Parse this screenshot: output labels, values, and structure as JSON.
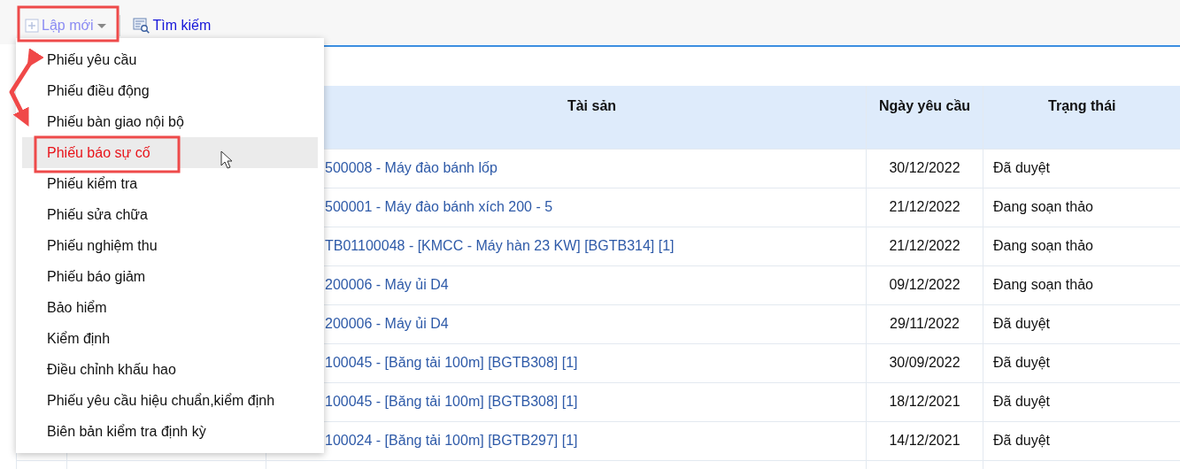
{
  "toolbar": {
    "buttons": [
      {
        "label": "Lập mới",
        "kind": "dropdown"
      },
      {
        "label": "Tìm kiếm",
        "kind": "search"
      }
    ]
  },
  "menu": {
    "items": [
      {
        "label": "Phiếu yêu cầu",
        "selected": false
      },
      {
        "label": "Phiếu điều động",
        "selected": false
      },
      {
        "label": "Phiếu bàn giao nội bộ",
        "selected": false
      },
      {
        "label": "Phiếu báo sự cố",
        "selected": true
      },
      {
        "label": "Phiếu kiểm tra",
        "selected": false
      },
      {
        "label": "Phiếu sửa chữa",
        "selected": false
      },
      {
        "label": "Phiếu nghiệm thu",
        "selected": false
      },
      {
        "label": "Phiếu báo giảm",
        "selected": false
      },
      {
        "label": "Bảo hiểm",
        "selected": false
      },
      {
        "label": "Kiểm định",
        "selected": false
      },
      {
        "label": "Điều chỉnh khấu hao",
        "selected": false
      },
      {
        "label": "Phiếu yêu cầu hiệu chuẩn,kiểm định",
        "selected": false
      },
      {
        "label": "Biên bản kiểm tra định kỳ",
        "selected": false
      }
    ]
  },
  "table": {
    "columns": [
      "Tài sản",
      "Ngày yêu cầu",
      "Trạng thái"
    ],
    "rows": [
      {
        "asset": "500008 - Máy đào bánh lốp",
        "date": "30/12/2022",
        "status": "Đã duyệt"
      },
      {
        "asset": "500001 - Máy đào bánh xích 200 - 5",
        "date": "21/12/2022",
        "status": "Đang soạn thảo"
      },
      {
        "asset": "TB01100048 - [KMCC - Máy hàn 23 KW] [BGTB314] [1]",
        "date": "21/12/2022",
        "status": "Đang soạn thảo"
      },
      {
        "asset": "200006 - Máy ủi D4",
        "date": "09/12/2022",
        "status": "Đang soạn thảo"
      },
      {
        "asset": "200006 - Máy ủi D4",
        "date": "29/11/2022",
        "status": "Đã duyệt"
      },
      {
        "asset": "100045 - [Băng tải 100m] [BGTB308] [1]",
        "date": "30/09/2022",
        "status": "Đã duyệt"
      },
      {
        "asset": "100045 - [Băng tải 100m] [BGTB308] [1]",
        "date": "18/12/2021",
        "status": "Đã duyệt"
      },
      {
        "asset": "100024 - [Băng tải 100m] [BGTB297] [1]",
        "date": "14/12/2021",
        "status": "Đã duyệt"
      }
    ]
  }
}
